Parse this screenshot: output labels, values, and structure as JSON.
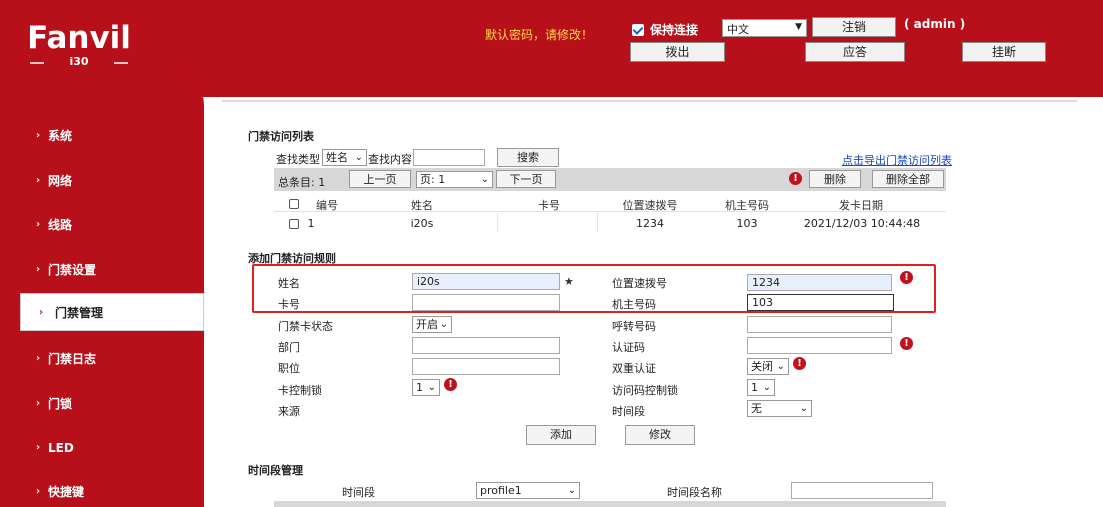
{
  "brand": {
    "logo": "Fanvil",
    "model": "i30"
  },
  "header": {
    "warning": "默认密码，请修改！",
    "keep_connected": "保持连接",
    "language": "中文",
    "logout": "注销",
    "user": "( admin )",
    "dial": "拨出",
    "answer": "应答",
    "hangup": "挂断"
  },
  "sidebar": {
    "items": [
      {
        "label": "系统"
      },
      {
        "label": "网络"
      },
      {
        "label": "线路"
      },
      {
        "label": "门禁设置"
      },
      {
        "label": "门禁管理"
      },
      {
        "label": "门禁日志"
      },
      {
        "label": "门锁"
      },
      {
        "label": "LED"
      },
      {
        "label": "快捷键"
      }
    ],
    "active_index": 4
  },
  "access_list": {
    "title": "门禁访问列表",
    "search_type_label": "查找类型",
    "search_type_value": "姓名",
    "search_content_label": "查找内容",
    "search_button": "搜索",
    "export_link": "点击导出门禁访问列表",
    "total_label": "总条目: 1",
    "prev_page": "上一页",
    "page_label": "页: 1",
    "next_page": "下一页",
    "delete": "删除",
    "delete_all": "删除全部",
    "columns": [
      "编号",
      "姓名",
      "卡号",
      "位置速拨号",
      "机主号码",
      "发卡日期"
    ],
    "rows": [
      {
        "id": "1",
        "name": "i20s",
        "card": "",
        "location": "1234",
        "owner": "103",
        "date": "2021/12/03 10:44:48"
      }
    ]
  },
  "add_rule": {
    "title": "添加门禁访问规则",
    "name_label": "姓名",
    "name_value": "i20s",
    "location_label": "位置速拨号",
    "location_value": "1234",
    "card_label": "卡号",
    "card_value": "",
    "owner_label": "机主号码",
    "owner_value": "103",
    "card_status_label": "门禁卡状态",
    "card_status_value": "开启",
    "forward_label": "呼转号码",
    "dept_label": "部门",
    "auth_label": "认证码",
    "position_label": "职位",
    "double_auth_label": "双重认证",
    "double_auth_value": "关闭",
    "card_lock_label": "卡控制锁",
    "card_lock_value": "1",
    "access_lock_label": "访问码控制锁",
    "access_lock_value": "1",
    "source_label": "来源",
    "time_seg_label": "时间段",
    "time_seg_value": "无",
    "add_button": "添加",
    "modify_button": "修改"
  },
  "time_mgmt": {
    "title": "时间段管理",
    "time_seg_label": "时间段",
    "time_seg_value": "profile1",
    "time_seg_name_label": "时间段名称"
  }
}
